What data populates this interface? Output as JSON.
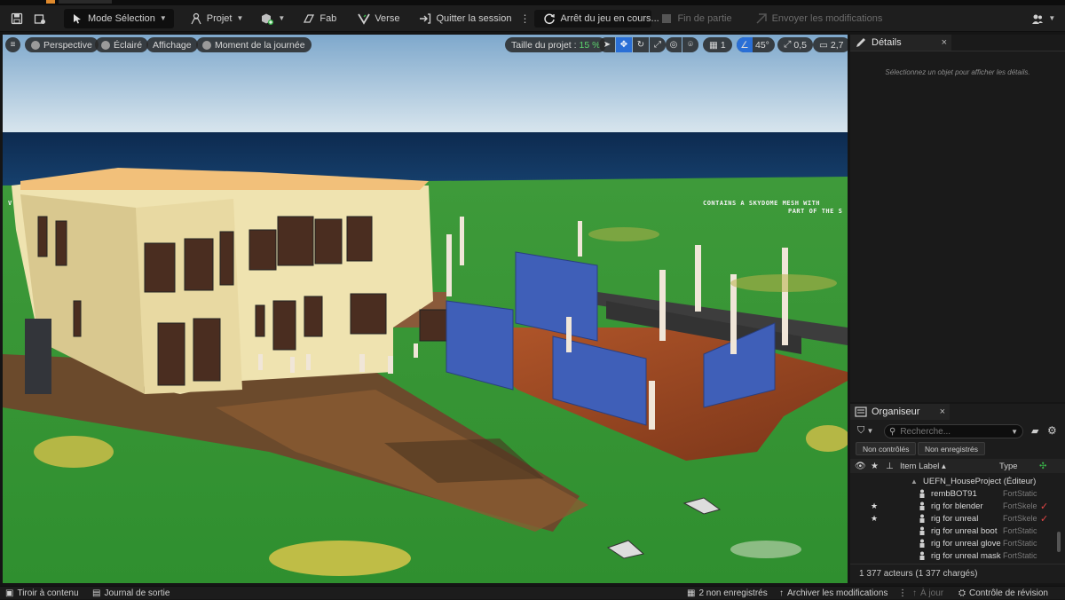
{
  "toolbar": {
    "mode": "Mode Sélection",
    "projet": "Projet",
    "fab": "Fab",
    "verse": "Verse",
    "quitter": "Quitter la session",
    "status": "Arrêt du jeu en cours...",
    "fin_partie": "Fin de partie",
    "envoyer": "Envoyer les modifications"
  },
  "viewport": {
    "perspective": "Perspective",
    "eclaire": "Éclairé",
    "affichage": "Affichage",
    "moment": "Moment de la journée",
    "taille_label": "Taille du projet :",
    "taille_value": "15 %",
    "grid_value": "1",
    "angle_value": "45°",
    "scale_value": "0,5",
    "camera_value": "2,7",
    "overlay_line1": "CONTAINS A SKYDOME MESH WITH",
    "overlay_line2": "PART OF THE S",
    "overlay_left": "V"
  },
  "details": {
    "title": "Détails",
    "close": "×",
    "message": "Sélectionnez un objet pour afficher les détails."
  },
  "outliner": {
    "title": "Organiseur",
    "close": "×",
    "search_placeholder": "Recherche...",
    "filter1": "Non contrôlés",
    "filter2": "Non enregistrés",
    "col_label": "Item Label ▴",
    "col_type": "Type",
    "root": "UEFN_HouseProject (Éditeur)",
    "rows": [
      {
        "label": "rembBOT91",
        "type": "FortStatic",
        "star": "",
        "check": ""
      },
      {
        "label": "rig for blender",
        "type": "FortSkele",
        "star": "★",
        "check": "✓"
      },
      {
        "label": "rig for unreal",
        "type": "FortSkele",
        "star": "★",
        "check": "✓"
      },
      {
        "label": "rig for unreal boot",
        "type": "FortStatic",
        "star": "",
        "check": ""
      },
      {
        "label": "rig for unreal glove",
        "type": "FortStatic",
        "star": "",
        "check": ""
      },
      {
        "label": "rig for unreal mask",
        "type": "FortStatic",
        "star": "",
        "check": ""
      }
    ],
    "footer": "1 377 acteurs (1 377 chargés)"
  },
  "bottombar": {
    "tiroir": "Tiroir à contenu",
    "journal": "Journal de sortie",
    "non_enregistres": "2 non enregistrés",
    "archiver": "Archiver les modifications",
    "a_jour": "À jour",
    "controle": "Contrôle de révision"
  }
}
